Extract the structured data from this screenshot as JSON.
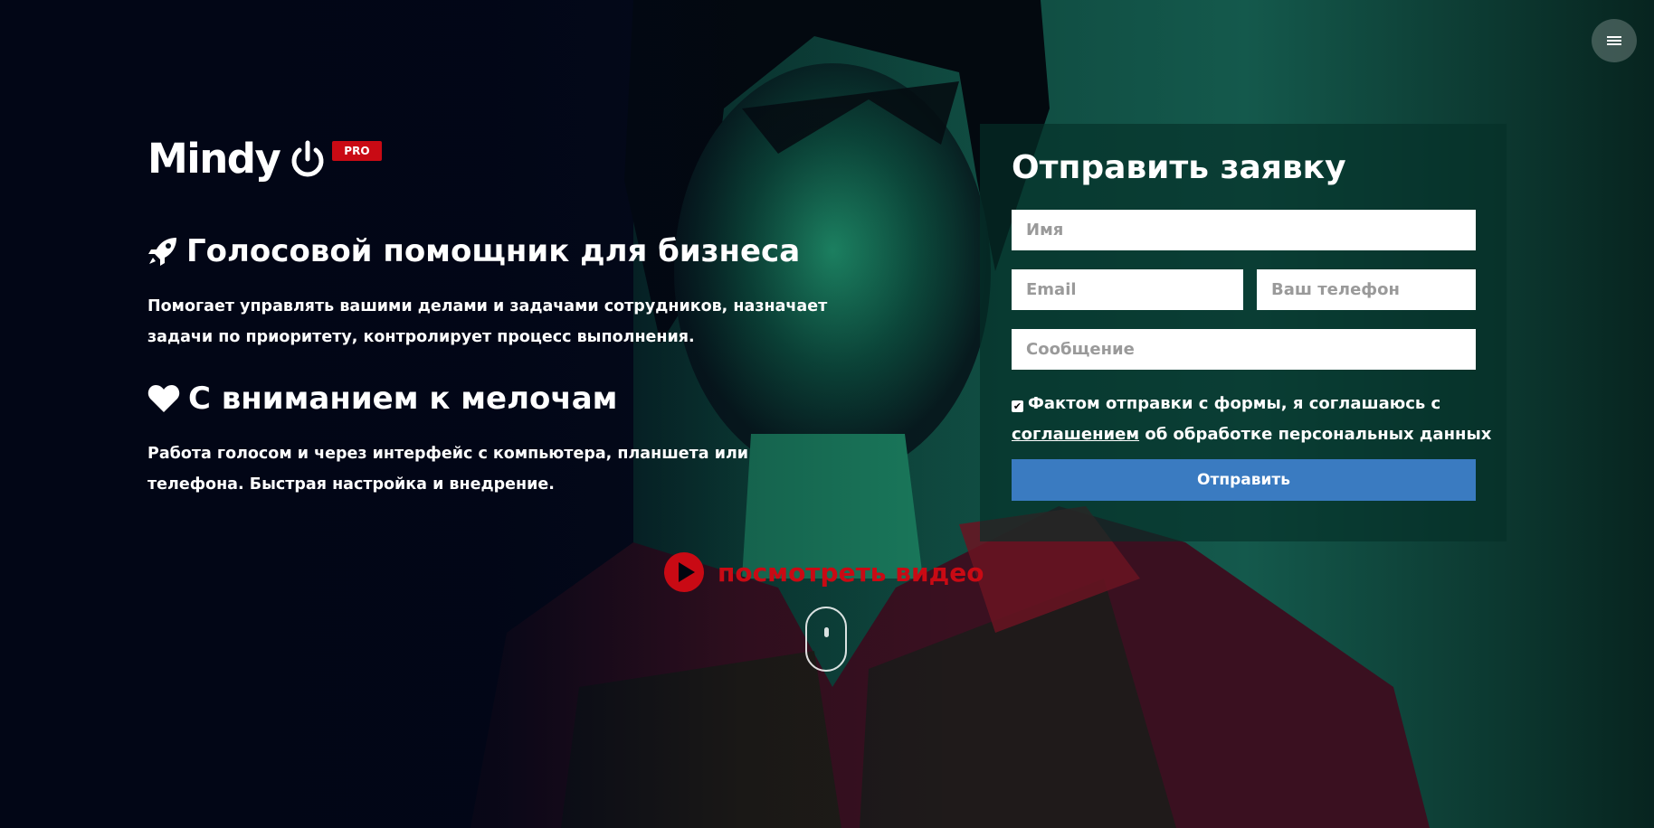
{
  "header": {
    "menu_icon": "hamburger-menu-icon"
  },
  "logo": {
    "text": "Mindy",
    "icon": "power-icon",
    "badge": "PRO"
  },
  "features": [
    {
      "icon": "rocket-icon",
      "title": "Голосовой помощник для бизнеса",
      "text": "Помогает управлять вашими делами и задачами сотрудников, назначает задачи по приоритету, контролирует процесс выполнения."
    },
    {
      "icon": "heart-icon",
      "title": "С вниманием к мелочам",
      "text": "Работа голосом и через интерфейс с компьютера, планшета или телефона. Быстрая настройка и внедрение."
    }
  ],
  "video": {
    "icon": "play-icon",
    "label": "посмотреть видео"
  },
  "scroll_icon": "mouse-scroll-icon",
  "form": {
    "title": "Отправить заявку",
    "name_placeholder": "Имя",
    "email_placeholder": "Email",
    "phone_placeholder": "Ваш телефон",
    "message_placeholder": "Сообщение",
    "consent_checked": true,
    "consent_before": "Фактом отправки с формы, я соглашаюсь с",
    "consent_link": "соглашением",
    "consent_after": "об обработке персональных данных",
    "submit_label": "Отправить"
  },
  "colors": {
    "brand_red": "#c90a14",
    "submit_blue": "#3a7bc1",
    "panel_green": "#043028"
  }
}
